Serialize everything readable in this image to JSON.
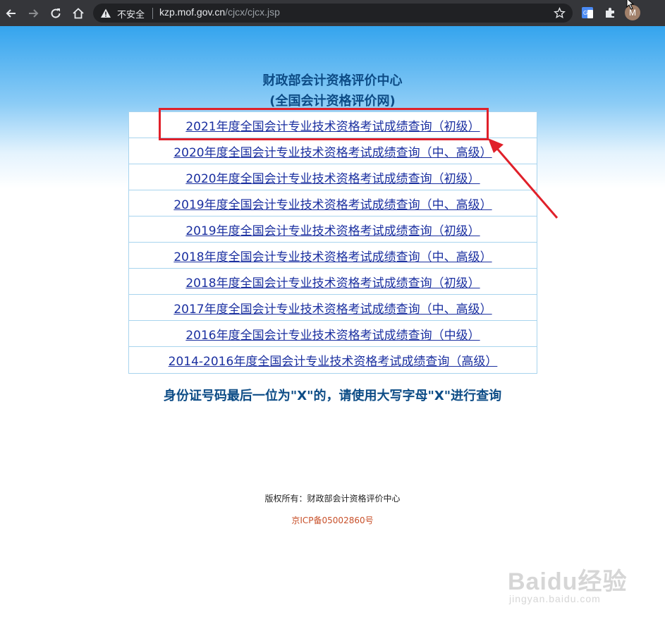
{
  "browser": {
    "security_label": "不安全",
    "url_host": "kzp.mof.gov.cn",
    "url_path": "/cjcx/cjcx.jsp",
    "avatar_initial": "M"
  },
  "header": {
    "title": "财政部会计资格评价中心",
    "subtitle": "(全国会计资格评价网)"
  },
  "links": [
    "2021年度全国会计专业技术资格考试成绩查询（初级）",
    "2020年度全国会计专业技术资格考试成绩查询（中、高级）",
    "2020年度全国会计专业技术资格考试成绩查询（初级）",
    "2019年度全国会计专业技术资格考试成绩查询（中、高级）",
    "2019年度全国会计专业技术资格考试成绩查询（初级）",
    "2018年度全国会计专业技术资格考试成绩查询（中、高级）",
    "2018年度全国会计专业技术资格考试成绩查询（初级）",
    "2017年度全国会计专业技术资格考试成绩查询（中、高级）",
    "2016年度全国会计专业技术资格考试成绩查询（中级）",
    "2014-2016年度全国会计专业技术资格考试成绩查询（高级）"
  ],
  "notice": "身份证号码最后一位为\"X\"的，请使用大写字母\"X\"进行查询",
  "footer": {
    "copyright": "版权所有：财政部会计资格评价中心",
    "icp": "京ICP备05002860号"
  },
  "watermark": {
    "brand": "Baidu经验",
    "url": "jingyan.baidu.com"
  },
  "colors": {
    "link": "#1a2fa0",
    "title": "#0d4c86",
    "highlight": "#e0202a",
    "icp": "#c8502a"
  }
}
